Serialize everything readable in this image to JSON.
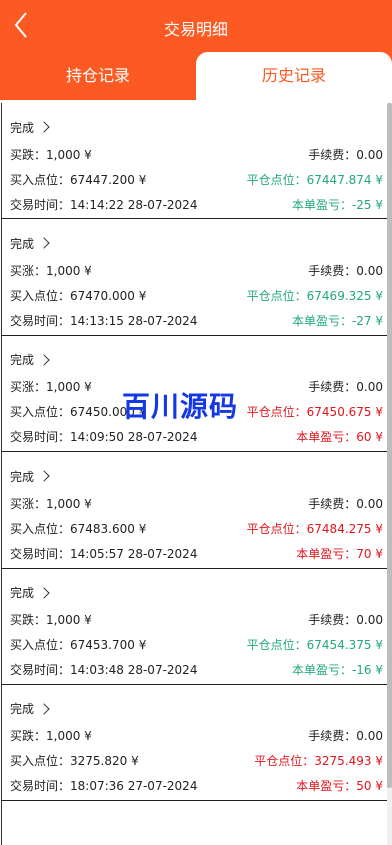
{
  "header": {
    "title": "交易明细",
    "tabs": [
      {
        "label": "持仓记录"
      },
      {
        "label": "历史记录"
      }
    ]
  },
  "watermark": "百川源码",
  "colors": {
    "accent": "#fc5a22",
    "profit": "#e0161d",
    "loss": "#22a97b"
  },
  "records": [
    {
      "status": "完成",
      "side": "买跌：1,000 ¥",
      "fee": "手续费：0.00",
      "open": "买入点位：67447.200 ¥",
      "close": "平仓点位：67447.874 ¥",
      "time": "交易时间：14:14:22 28-07-2024",
      "pnl": "本单盈亏：-25 ¥",
      "tone": "green"
    },
    {
      "status": "完成",
      "side": "买涨：1,000 ¥",
      "fee": "手续费：0.00",
      "open": "买入点位：67470.000 ¥",
      "close": "平仓点位：67469.325 ¥",
      "time": "交易时间：14:13:15 28-07-2024",
      "pnl": "本单盈亏：-27 ¥",
      "tone": "green"
    },
    {
      "status": "完成",
      "side": "买涨：1,000 ¥",
      "fee": "手续费：0.00",
      "open": "买入点位：67450.000 ¥",
      "close": "平仓点位：67450.675 ¥",
      "time": "交易时间：14:09:50 28-07-2024",
      "pnl": "本单盈亏：60 ¥",
      "tone": "red"
    },
    {
      "status": "完成",
      "side": "买涨：1,000 ¥",
      "fee": "手续费：0.00",
      "open": "买入点位：67483.600 ¥",
      "close": "平仓点位：67484.275 ¥",
      "time": "交易时间：14:05:57 28-07-2024",
      "pnl": "本单盈亏：70 ¥",
      "tone": "red"
    },
    {
      "status": "完成",
      "side": "买跌：1,000 ¥",
      "fee": "手续费：0.00",
      "open": "买入点位：67453.700 ¥",
      "close": "平仓点位：67454.375 ¥",
      "time": "交易时间：14:03:48 28-07-2024",
      "pnl": "本单盈亏：-16 ¥",
      "tone": "green"
    },
    {
      "status": "完成",
      "side": "买跌：1,000 ¥",
      "fee": "手续费：0.00",
      "open": "买入点位：3275.820 ¥",
      "close": "平仓点位：3275.493 ¥",
      "time": "交易时间：18:07:36 27-07-2024",
      "pnl": "本单盈亏：50 ¥",
      "tone": "red"
    }
  ]
}
